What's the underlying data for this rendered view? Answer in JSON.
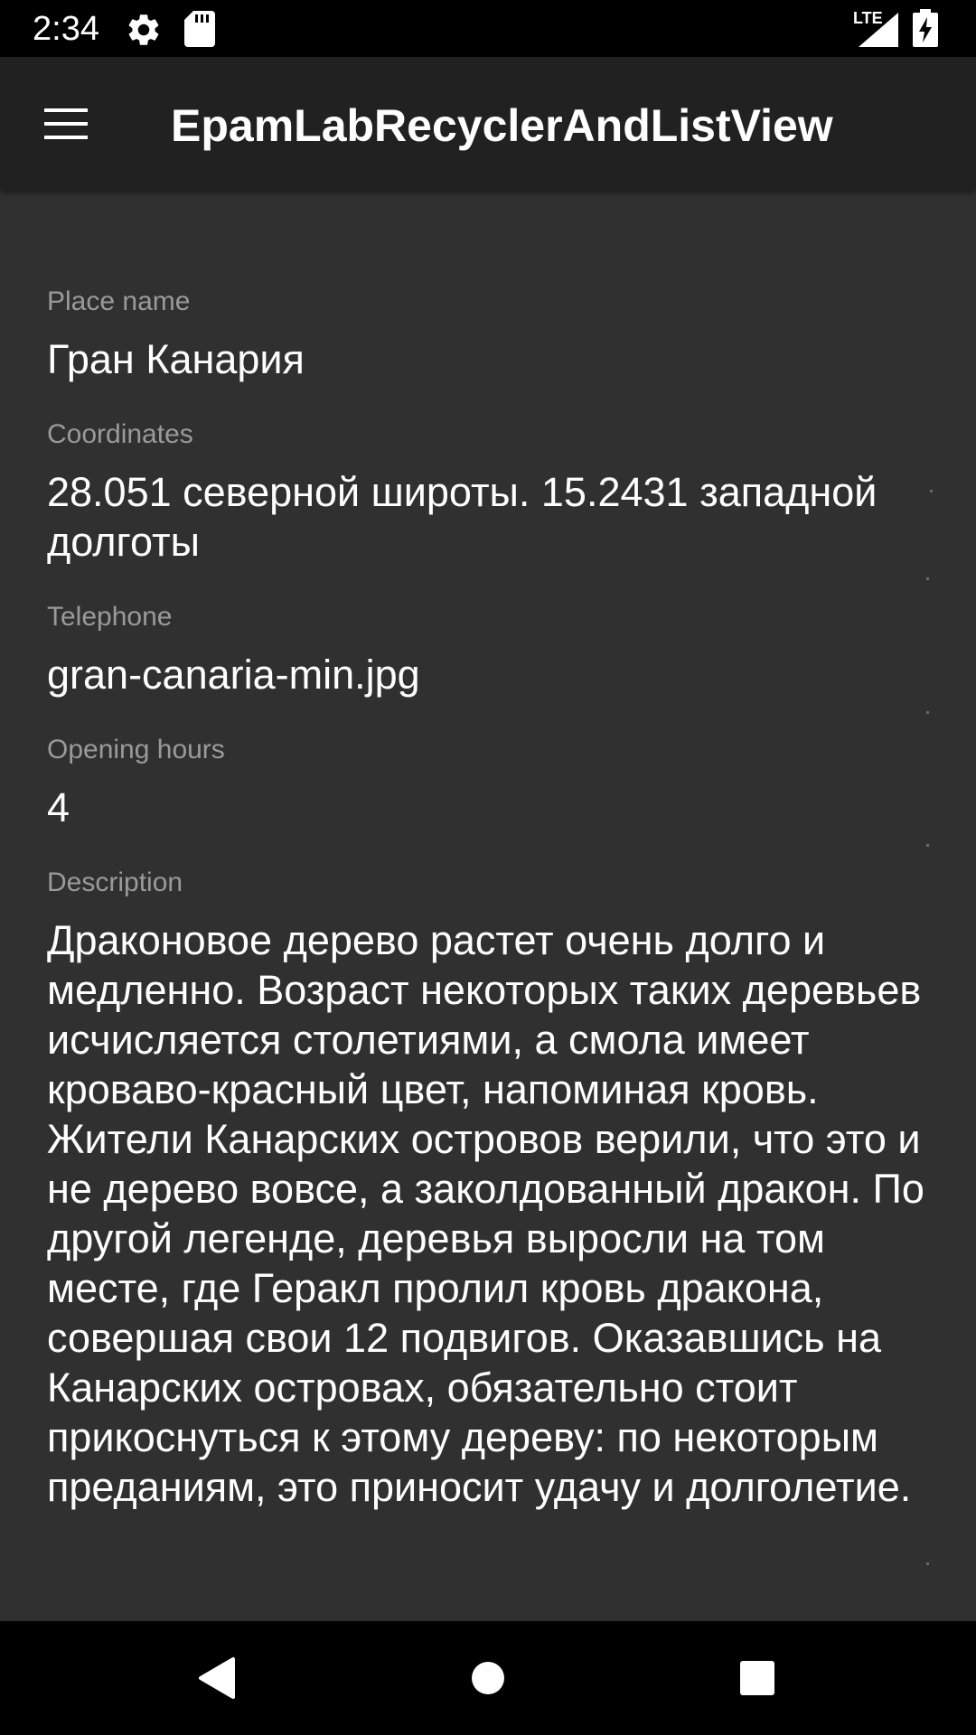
{
  "status_bar": {
    "time": "2:34",
    "network_label": "LTE",
    "icons": [
      "settings-icon",
      "sd-card-icon",
      "signal-icon",
      "battery-charging-icon"
    ]
  },
  "app_bar": {
    "title": "EpamLabRecyclerAndListView",
    "menu_icon": "hamburger-menu-icon"
  },
  "fields": {
    "place_name": {
      "label": "Place name",
      "value": "Гран Канария"
    },
    "coordinates": {
      "label": "Coordinates",
      "value": "28.051 северной широты. 15.2431 западной долготы"
    },
    "telephone": {
      "label": "Telephone",
      "value": "gran-canaria-min.jpg"
    },
    "opening_hours": {
      "label": "Opening hours",
      "value": "4"
    },
    "description": {
      "label": "Description",
      "value": "Драконовое дерево растет очень долго и медленно. Возраст некоторых таких деревьев исчисляется столетиями, а смола имеет кроваво-красный цвет, напоминая кровь. Жители Канарских островов верили, что это и не дерево вовсе, а заколдованный дракон. По другой легенде, деревья выросли на том месте, где Геракл пролил кровь дракона, совершая свои 12 подвигов. Оказавшись на Канарских островах, обязательно стоит прикоснуться к этому дереву: по некоторым преданиям, это приносит удачу и долголетие."
    }
  },
  "nav_bar": {
    "icons": [
      "back-icon",
      "home-icon",
      "recents-icon"
    ]
  },
  "colors": {
    "status_bar": "#000000",
    "app_bar": "#212121",
    "background": "#303030",
    "label": "#9a9a9a",
    "value": "#ffffff",
    "nav_bar": "#000000"
  }
}
